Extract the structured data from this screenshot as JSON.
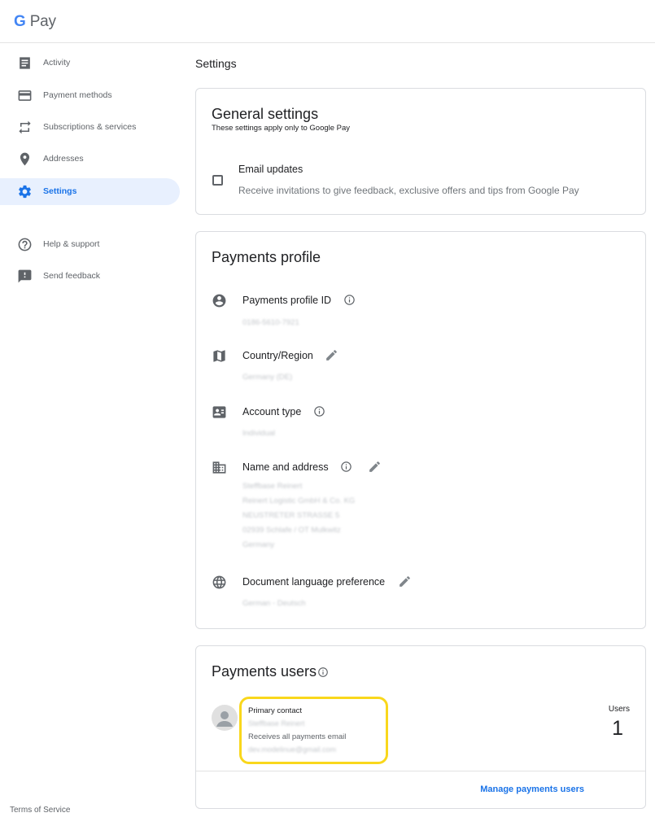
{
  "app": {
    "logo_g": "G",
    "logo_text": "Pay"
  },
  "sidebar": {
    "items": [
      {
        "label": "Activity",
        "icon": "activity-icon",
        "active": false
      },
      {
        "label": "Payment methods",
        "icon": "credit-card-icon",
        "active": false
      },
      {
        "label": "Subscriptions & services",
        "icon": "repeat-icon",
        "active": false
      },
      {
        "label": "Addresses",
        "icon": "location-pin-icon",
        "active": false
      },
      {
        "label": "Settings",
        "icon": "gear-icon",
        "active": true
      },
      {
        "label": "Help & support",
        "icon": "help-icon",
        "active": false
      },
      {
        "label": "Send feedback",
        "icon": "feedback-icon",
        "active": false
      }
    ],
    "terms": "Terms of Service"
  },
  "page": {
    "title": "Settings"
  },
  "general": {
    "title": "General settings",
    "subtitle": "These settings apply only to Google Pay",
    "email_title": "Email updates",
    "email_desc": "Receive invitations to give feedback, exclusive offers and tips from Google Pay",
    "email_checked": false
  },
  "profile": {
    "title": "Payments profile",
    "id_label": "Payments profile ID",
    "id_value": "0186-5610-7921",
    "country_label": "Country/Region",
    "country_value": "Germany (DE)",
    "account_label": "Account type",
    "account_value": "Individual",
    "name_label": "Name and address",
    "name_lines": [
      "Steffbase Reinert",
      "Reinert Logistic GmbH & Co. KG",
      "NEUSTRETER STRASSE 5",
      "02939 Schlafe / OT Mulkwitz",
      "Germany"
    ],
    "lang_label": "Document language preference",
    "lang_value": "German - Deutsch"
  },
  "users": {
    "title": "Payments users",
    "primary_label": "Primary contact",
    "primary_name": "Steffbase Reinert",
    "receives": "Receives all payments email",
    "email": "dev.modelinue@gmail.com",
    "users_label": "Users",
    "users_count": "1",
    "manage_link": "Manage payments users"
  },
  "colors": {
    "accent": "#1a73e8",
    "active_bg": "#e8f0fe",
    "highlight": "#f9d71c",
    "icon": "#5f6368"
  }
}
